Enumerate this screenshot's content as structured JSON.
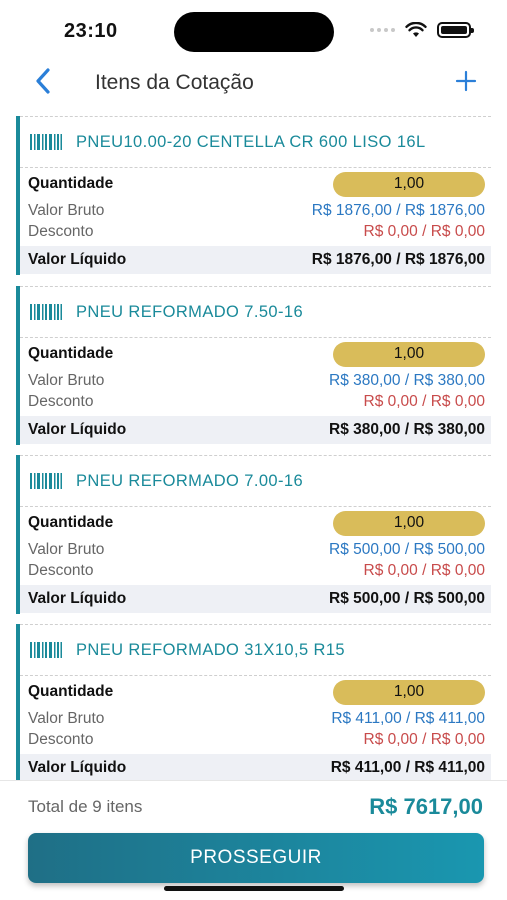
{
  "status_bar": {
    "time": "23:10"
  },
  "nav": {
    "title": "Itens da Cotação",
    "back_icon": "chevron-left-icon",
    "add_icon": "plus-icon"
  },
  "labels": {
    "quantidade": "Quantidade",
    "valor_bruto": "Valor Bruto",
    "desconto": "Desconto",
    "valor_liquido": "Valor Líquido"
  },
  "items": [
    {
      "name": "PNEU10.00-20 CENTELLA CR 600 LISO 16L",
      "quantity": "1,00",
      "gross": "R$ 1876,00 / R$ 1876,00",
      "discount": "R$ 0,00 / R$ 0,00",
      "net": "R$ 1876,00 / R$ 1876,00"
    },
    {
      "name": "PNEU REFORMADO 7.50-16",
      "quantity": "1,00",
      "gross": "R$ 380,00 / R$ 380,00",
      "discount": "R$ 0,00 / R$ 0,00",
      "net": "R$ 380,00 / R$ 380,00"
    },
    {
      "name": "PNEU REFORMADO 7.00-16",
      "quantity": "1,00",
      "gross": "R$ 500,00 / R$ 500,00",
      "discount": "R$ 0,00 / R$ 0,00",
      "net": "R$ 500,00 / R$ 500,00"
    },
    {
      "name": "PNEU REFORMADO 31X10,5 R15",
      "quantity": "1,00",
      "gross": "R$ 411,00 / R$ 411,00",
      "discount": "R$ 0,00 / R$ 0,00",
      "net": "R$ 411,00 / R$ 411,00"
    }
  ],
  "footer": {
    "total_label": "Total de 9 itens",
    "total_value": "R$ 7617,00",
    "proceed_label": "PROSSEGUIR"
  },
  "colors": {
    "accent": "#1a8a9a",
    "quantity_pill": "#d9bc5a",
    "gross": "#2b78c2",
    "discount": "#c84b4b"
  }
}
